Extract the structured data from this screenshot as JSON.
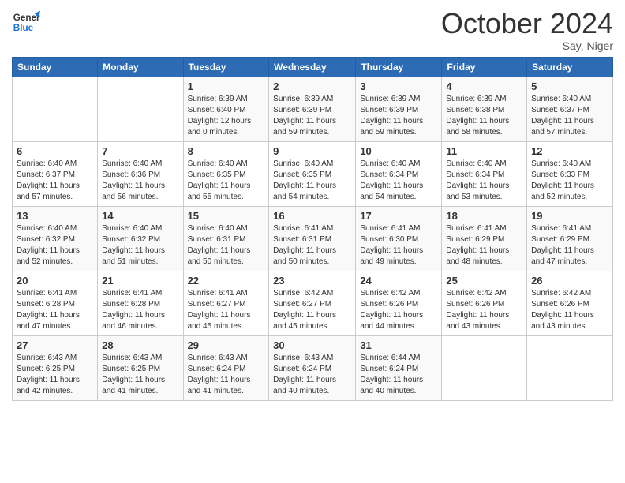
{
  "logo": {
    "line1": "General",
    "line2": "Blue"
  },
  "title": "October 2024",
  "subtitle": "Say, Niger",
  "days_header": [
    "Sunday",
    "Monday",
    "Tuesday",
    "Wednesday",
    "Thursday",
    "Friday",
    "Saturday"
  ],
  "weeks": [
    [
      {
        "num": "",
        "info": ""
      },
      {
        "num": "",
        "info": ""
      },
      {
        "num": "1",
        "info": "Sunrise: 6:39 AM\nSunset: 6:40 PM\nDaylight: 12 hours and 0 minutes."
      },
      {
        "num": "2",
        "info": "Sunrise: 6:39 AM\nSunset: 6:39 PM\nDaylight: 11 hours and 59 minutes."
      },
      {
        "num": "3",
        "info": "Sunrise: 6:39 AM\nSunset: 6:39 PM\nDaylight: 11 hours and 59 minutes."
      },
      {
        "num": "4",
        "info": "Sunrise: 6:39 AM\nSunset: 6:38 PM\nDaylight: 11 hours and 58 minutes."
      },
      {
        "num": "5",
        "info": "Sunrise: 6:40 AM\nSunset: 6:37 PM\nDaylight: 11 hours and 57 minutes."
      }
    ],
    [
      {
        "num": "6",
        "info": "Sunrise: 6:40 AM\nSunset: 6:37 PM\nDaylight: 11 hours and 57 minutes."
      },
      {
        "num": "7",
        "info": "Sunrise: 6:40 AM\nSunset: 6:36 PM\nDaylight: 11 hours and 56 minutes."
      },
      {
        "num": "8",
        "info": "Sunrise: 6:40 AM\nSunset: 6:35 PM\nDaylight: 11 hours and 55 minutes."
      },
      {
        "num": "9",
        "info": "Sunrise: 6:40 AM\nSunset: 6:35 PM\nDaylight: 11 hours and 54 minutes."
      },
      {
        "num": "10",
        "info": "Sunrise: 6:40 AM\nSunset: 6:34 PM\nDaylight: 11 hours and 54 minutes."
      },
      {
        "num": "11",
        "info": "Sunrise: 6:40 AM\nSunset: 6:34 PM\nDaylight: 11 hours and 53 minutes."
      },
      {
        "num": "12",
        "info": "Sunrise: 6:40 AM\nSunset: 6:33 PM\nDaylight: 11 hours and 52 minutes."
      }
    ],
    [
      {
        "num": "13",
        "info": "Sunrise: 6:40 AM\nSunset: 6:32 PM\nDaylight: 11 hours and 52 minutes."
      },
      {
        "num": "14",
        "info": "Sunrise: 6:40 AM\nSunset: 6:32 PM\nDaylight: 11 hours and 51 minutes."
      },
      {
        "num": "15",
        "info": "Sunrise: 6:40 AM\nSunset: 6:31 PM\nDaylight: 11 hours and 50 minutes."
      },
      {
        "num": "16",
        "info": "Sunrise: 6:41 AM\nSunset: 6:31 PM\nDaylight: 11 hours and 50 minutes."
      },
      {
        "num": "17",
        "info": "Sunrise: 6:41 AM\nSunset: 6:30 PM\nDaylight: 11 hours and 49 minutes."
      },
      {
        "num": "18",
        "info": "Sunrise: 6:41 AM\nSunset: 6:29 PM\nDaylight: 11 hours and 48 minutes."
      },
      {
        "num": "19",
        "info": "Sunrise: 6:41 AM\nSunset: 6:29 PM\nDaylight: 11 hours and 47 minutes."
      }
    ],
    [
      {
        "num": "20",
        "info": "Sunrise: 6:41 AM\nSunset: 6:28 PM\nDaylight: 11 hours and 47 minutes."
      },
      {
        "num": "21",
        "info": "Sunrise: 6:41 AM\nSunset: 6:28 PM\nDaylight: 11 hours and 46 minutes."
      },
      {
        "num": "22",
        "info": "Sunrise: 6:41 AM\nSunset: 6:27 PM\nDaylight: 11 hours and 45 minutes."
      },
      {
        "num": "23",
        "info": "Sunrise: 6:42 AM\nSunset: 6:27 PM\nDaylight: 11 hours and 45 minutes."
      },
      {
        "num": "24",
        "info": "Sunrise: 6:42 AM\nSunset: 6:26 PM\nDaylight: 11 hours and 44 minutes."
      },
      {
        "num": "25",
        "info": "Sunrise: 6:42 AM\nSunset: 6:26 PM\nDaylight: 11 hours and 43 minutes."
      },
      {
        "num": "26",
        "info": "Sunrise: 6:42 AM\nSunset: 6:26 PM\nDaylight: 11 hours and 43 minutes."
      }
    ],
    [
      {
        "num": "27",
        "info": "Sunrise: 6:43 AM\nSunset: 6:25 PM\nDaylight: 11 hours and 42 minutes."
      },
      {
        "num": "28",
        "info": "Sunrise: 6:43 AM\nSunset: 6:25 PM\nDaylight: 11 hours and 41 minutes."
      },
      {
        "num": "29",
        "info": "Sunrise: 6:43 AM\nSunset: 6:24 PM\nDaylight: 11 hours and 41 minutes."
      },
      {
        "num": "30",
        "info": "Sunrise: 6:43 AM\nSunset: 6:24 PM\nDaylight: 11 hours and 40 minutes."
      },
      {
        "num": "31",
        "info": "Sunrise: 6:44 AM\nSunset: 6:24 PM\nDaylight: 11 hours and 40 minutes."
      },
      {
        "num": "",
        "info": ""
      },
      {
        "num": "",
        "info": ""
      }
    ]
  ]
}
